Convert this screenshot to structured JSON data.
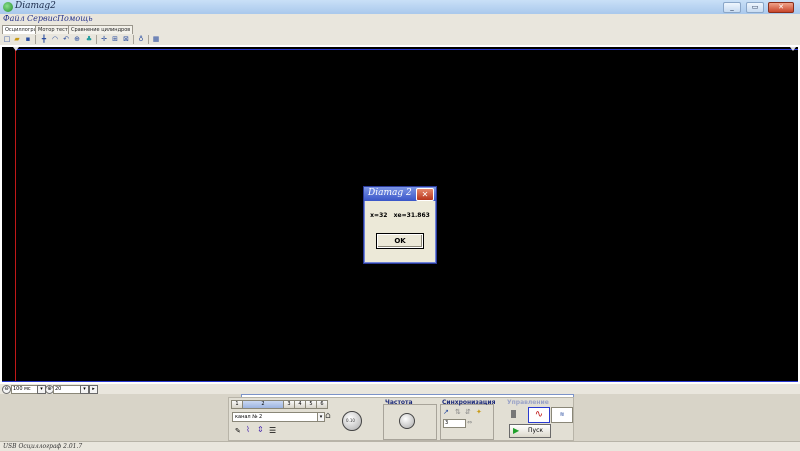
{
  "window": {
    "title": "Diamag2",
    "minimize": "_",
    "maximize": "▭",
    "close": "✕"
  },
  "menu": [
    "Файл",
    "Сервис",
    "Помощь"
  ],
  "tabs": [
    "Осциллограф",
    "Мотор тестер",
    "Сравнение цилиндров"
  ],
  "toolbar_icons": [
    "new-icon",
    "open-icon",
    "save-icon",
    "trace-icon",
    "cursor-icon",
    "undo-icon",
    "zoom-icon",
    "tree-icon",
    "measure-icon",
    "grid-icon",
    "compare-icon",
    "scale-icon",
    "table-icon"
  ],
  "dialog": {
    "title": "Diamag 2",
    "close": "✕",
    "message": "x=32   xe=31.863",
    "ok_label": "OK"
  },
  "scale_bar": {
    "time_value": "100  мс",
    "count_value": "20"
  },
  "channel_panel": {
    "channel_buttons": [
      "1",
      "2",
      "3",
      "4",
      "5",
      "6"
    ],
    "channel_select": "канал № 2",
    "freq_label": "Частота",
    "sync_label": "Синхронизация",
    "sync_value": "3",
    "control_label": "Управление",
    "start_label": "Пуск",
    "amp_knob_value": "0.10"
  },
  "colors": {
    "accent": "#2a3ad0",
    "trace": "#c01818",
    "screen": "#000000"
  },
  "status": "USB Осциллограф  2.01.7"
}
